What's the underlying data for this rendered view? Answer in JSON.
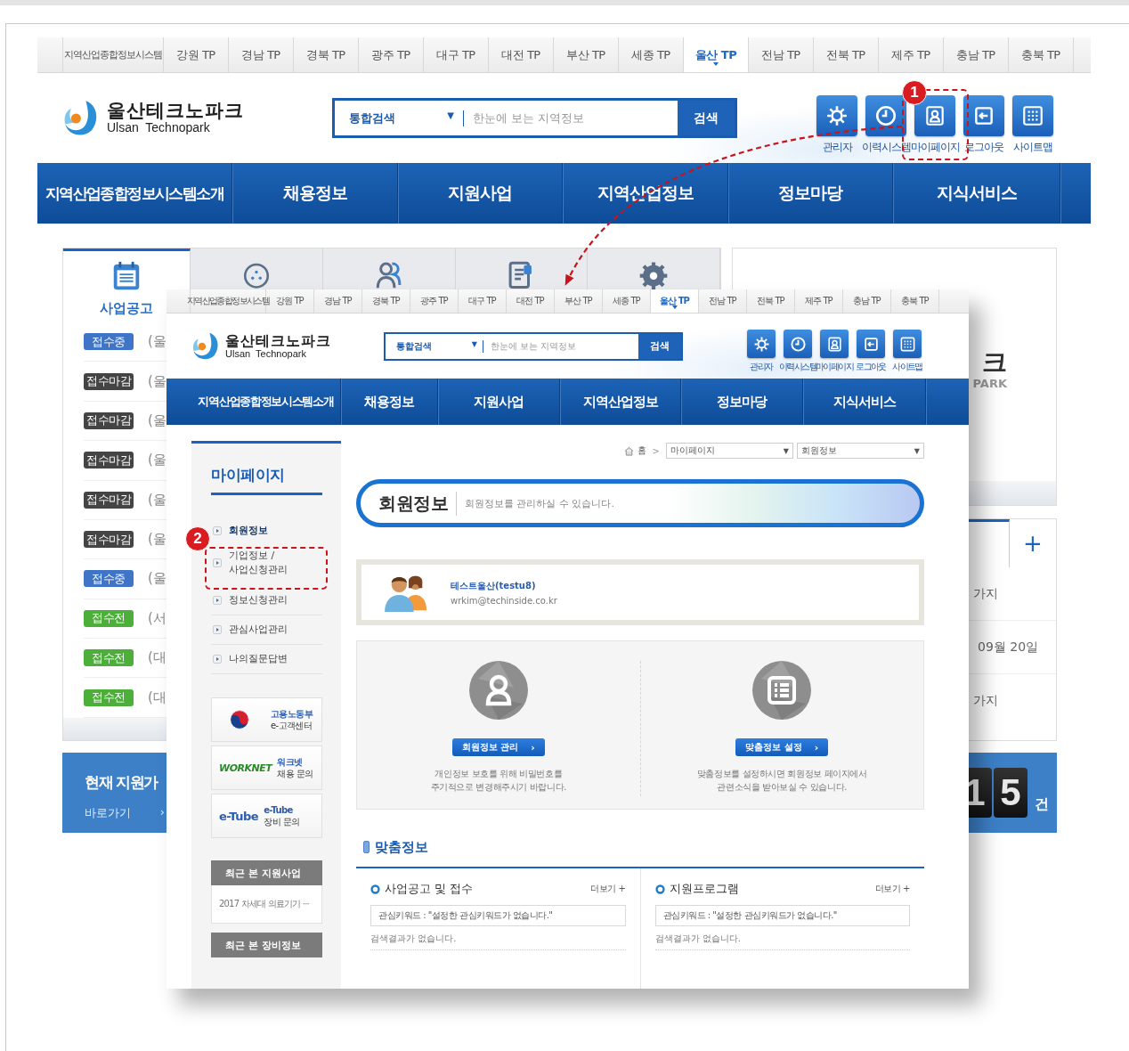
{
  "back_page": {
    "tp_tabs": [
      {
        "label": "지역산업종합정보시스템",
        "selected": false
      },
      {
        "label": "강원 TP",
        "selected": false
      },
      {
        "label": "경남 TP",
        "selected": false
      },
      {
        "label": "경북 TP",
        "selected": false
      },
      {
        "label": "광주 TP",
        "selected": false
      },
      {
        "label": "대구 TP",
        "selected": false
      },
      {
        "label": "대전 TP",
        "selected": false
      },
      {
        "label": "부산 TP",
        "selected": false
      },
      {
        "label": "세종 TP",
        "selected": false
      },
      {
        "label": "울산 TP",
        "selected": true
      },
      {
        "label": "전남 TP",
        "selected": false
      },
      {
        "label": "전북 TP",
        "selected": false
      },
      {
        "label": "제주 TP",
        "selected": false
      },
      {
        "label": "충남 TP",
        "selected": false
      },
      {
        "label": "충북 TP",
        "selected": false
      }
    ],
    "logo": {
      "name": "울산테크노파크",
      "subtitle": "Ulsan  Technopark"
    },
    "search": {
      "scope": "통합검색",
      "scope_arrow": "▼",
      "placeholder": "한눈에 보는 지역정보",
      "button": "검색"
    },
    "quick_links": [
      {
        "label": "관리자"
      },
      {
        "label": "이력시스템"
      },
      {
        "label": "마이페이지"
      },
      {
        "label": "로그아웃"
      },
      {
        "label": "사이트맵"
      }
    ],
    "nav": [
      "지역산업종합정보시스템소개",
      "채용정보",
      "지원사업",
      "지역산업정보",
      "정보마당",
      "지식서비스"
    ],
    "board_tabs": [
      {
        "label": "사업공고",
        "selected": true
      },
      {
        "selected": false
      },
      {
        "selected": false
      },
      {
        "selected": false
      },
      {
        "selected": false
      }
    ],
    "notices": [
      {
        "status": "접수중",
        "color": "#3f74c6",
        "title": "(울"
      },
      {
        "status": "접수마감",
        "color": "#444444",
        "title": "(울"
      },
      {
        "status": "접수마감",
        "color": "#444444",
        "title": "(울"
      },
      {
        "status": "접수마감",
        "color": "#444444",
        "title": "(울"
      },
      {
        "status": "접수마감",
        "color": "#444444",
        "title": "(울"
      },
      {
        "status": "접수마감",
        "color": "#444444",
        "title": "(울"
      },
      {
        "status": "접수중",
        "color": "#3f74c6",
        "title": "(울"
      },
      {
        "status": "접수전",
        "color": "#4caf3a",
        "title": "(서"
      },
      {
        "status": "접수전",
        "color": "#4caf3a",
        "title": "(대"
      },
      {
        "status": "접수전",
        "color": "#4caf3a",
        "title": "(대"
      }
    ],
    "banner": {
      "title": "현재 지원가",
      "link": "바로가기",
      "arrow": "›"
    },
    "partner_logo": {
      "name": "크",
      "subtitle": "PARK"
    },
    "schedule_more": "+",
    "schedule": [
      "가지",
      "09월 20일",
      "가지"
    ],
    "counter": {
      "digits": [
        "1",
        "5"
      ],
      "unit": "건"
    }
  },
  "front_page": {
    "tp_tabs": [
      {
        "label": "지역산업종합정보시스템",
        "selected": false
      },
      {
        "label": "강원 TP",
        "selected": false
      },
      {
        "label": "경남 TP",
        "selected": false
      },
      {
        "label": "경북 TP",
        "selected": false
      },
      {
        "label": "광주 TP",
        "selected": false
      },
      {
        "label": "대구 TP",
        "selected": false
      },
      {
        "label": "대전 TP",
        "selected": false
      },
      {
        "label": "부산 TP",
        "selected": false
      },
      {
        "label": "세종 TP",
        "selected": false
      },
      {
        "label": "울산 TP",
        "selected": true
      },
      {
        "label": "전남 TP",
        "selected": false
      },
      {
        "label": "전북 TP",
        "selected": false
      },
      {
        "label": "제주 TP",
        "selected": false
      },
      {
        "label": "충남 TP",
        "selected": false
      },
      {
        "label": "충북 TP",
        "selected": false
      }
    ],
    "logo": {
      "name": "울산테크노파크",
      "subtitle": "Ulsan  Technopark"
    },
    "search": {
      "scope": "통합검색",
      "scope_arrow": "▼",
      "placeholder": "한눈에 보는 지역정보",
      "button": "검색"
    },
    "quick_links": [
      {
        "label": "관리자"
      },
      {
        "label": "이력시스템"
      },
      {
        "label": "마이페이지"
      },
      {
        "label": "로그아웃"
      },
      {
        "label": "사이트맵"
      }
    ],
    "nav": [
      "지역산업종합정보시스템소개",
      "채용정보",
      "지원사업",
      "지역산업정보",
      "정보마당",
      "지식서비스"
    ],
    "sidebar": {
      "title": "마이페이지",
      "items": [
        {
          "label": "회원정보",
          "selected": true
        },
        {
          "label": "기업정보 /\n사업신청관리",
          "selected": false
        },
        {
          "label": "정보신청관리",
          "selected": false
        },
        {
          "label": "관심사업관리",
          "selected": false
        },
        {
          "label": "나의질문답변",
          "selected": false
        }
      ],
      "help_links": [
        {
          "title": "고용노동부",
          "subtitle": "e-고객센터"
        },
        {
          "logo": "WORKNET",
          "title": "워크넷",
          "subtitle": "채용 문의"
        },
        {
          "logo": "e-Tube",
          "title": "e-Tube",
          "subtitle": "장비 문의"
        }
      ],
      "recent": [
        {
          "title": "최근 본 지원사업",
          "items": [
            "2017 차세대 의료기기 ···"
          ]
        },
        {
          "title": "최근 본 장비정보"
        }
      ]
    },
    "breadcrumb": {
      "home": "홈",
      "separator": ">",
      "selects": [
        {
          "value": "마이페이지",
          "arrow": "▼"
        },
        {
          "value": "회원정보",
          "arrow": "▼"
        }
      ]
    },
    "page_header": {
      "title": "회원정보",
      "description": "회원정보를 관리하실 수 있습니다."
    },
    "member": {
      "name": "테스트울산(testu8)",
      "email": "wrkim@techinside.co.kr"
    },
    "actions": [
      {
        "button": "회원정보 관리",
        "arrow": "›",
        "description": "개인정보 보호를 위해 비밀번호를\n주기적으로 변경해주시기 바랍니다."
      },
      {
        "button": "맞춤정보 설정",
        "arrow": "›",
        "description": "맞춤정보를 설정하시면 회원정보 페이지에서\n관련소식을 받아보실 수 있습니다."
      }
    ],
    "custom_info": {
      "title": "맞춤정보",
      "columns": [
        {
          "title": "사업공고 및 접수",
          "more": "더보기 +",
          "keyword": "관심키워드 : \"설정한 관심키워드가 없습니다.\"",
          "empty": "검색결과가 없습니다."
        },
        {
          "title": "지원프로그램",
          "more": "더보기 +",
          "keyword": "관심키워드 : \"설정한 관심키워드가 없습니다.\"",
          "empty": "검색결과가 없습니다."
        }
      ]
    }
  },
  "annotations": [
    {
      "number": "1"
    },
    {
      "number": "2"
    }
  ]
}
